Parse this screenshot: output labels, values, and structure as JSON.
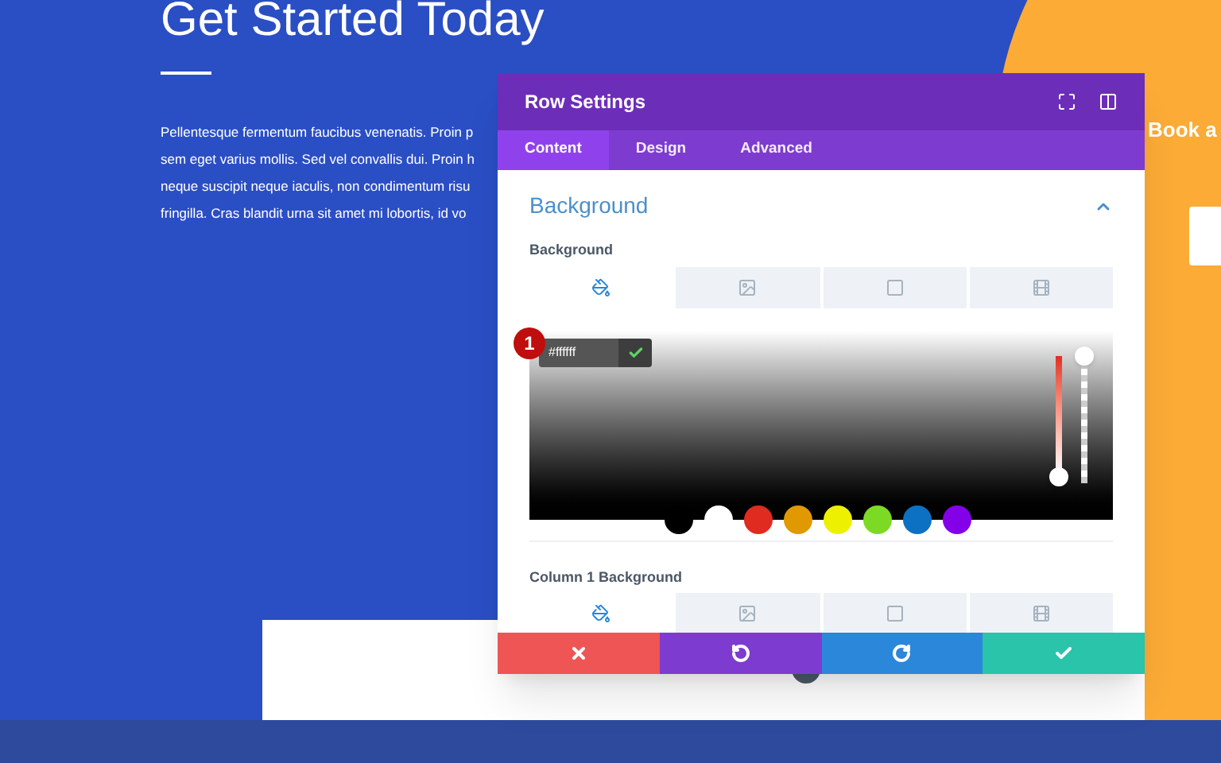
{
  "page": {
    "heading": "Get Started Today",
    "paragraph_lines": [
      "Pellentesque fermentum faucibus venenatis. Proin p",
      "sem eget varius mollis. Sed vel convallis dui. Proin h",
      "neque suscipit neque iaculis, non condimentum risu",
      "fringilla. Cras blandit urna sit amet mi lobortis, id vo"
    ],
    "side_text": "Book a"
  },
  "modal": {
    "title": "Row Settings",
    "tabs": [
      {
        "label": "Content",
        "selected": true
      },
      {
        "label": "Design",
        "selected": false
      },
      {
        "label": "Advanced",
        "selected": false
      }
    ],
    "section": {
      "title": "Background",
      "expanded": true
    },
    "background": {
      "label": "Background",
      "types": [
        {
          "kind": "color",
          "selected": true
        },
        {
          "kind": "gradient",
          "selected": false
        },
        {
          "kind": "image",
          "selected": false
        },
        {
          "kind": "video",
          "selected": false
        }
      ]
    },
    "picker": {
      "badge": "1",
      "hex": "#ffffff",
      "hue": {
        "level": 0
      },
      "opacity": {
        "level": 1
      },
      "swatches": [
        {
          "color": "#000000"
        },
        {
          "color": "#ffffff"
        },
        {
          "color": "#e02b20"
        },
        {
          "color": "#e09900"
        },
        {
          "color": "#edf000"
        },
        {
          "color": "#7cda24"
        },
        {
          "color": "#0c71c3"
        },
        {
          "color": "#8300e9"
        }
      ]
    },
    "column_background": {
      "label": "Column 1 Background",
      "types": [
        {
          "kind": "color",
          "selected": true
        },
        {
          "kind": "gradient",
          "selected": false
        },
        {
          "kind": "image",
          "selected": false
        },
        {
          "kind": "video",
          "selected": false
        }
      ]
    },
    "footer": [
      {
        "kind": "cancel"
      },
      {
        "kind": "undo"
      },
      {
        "kind": "redo"
      },
      {
        "kind": "save"
      }
    ]
  }
}
